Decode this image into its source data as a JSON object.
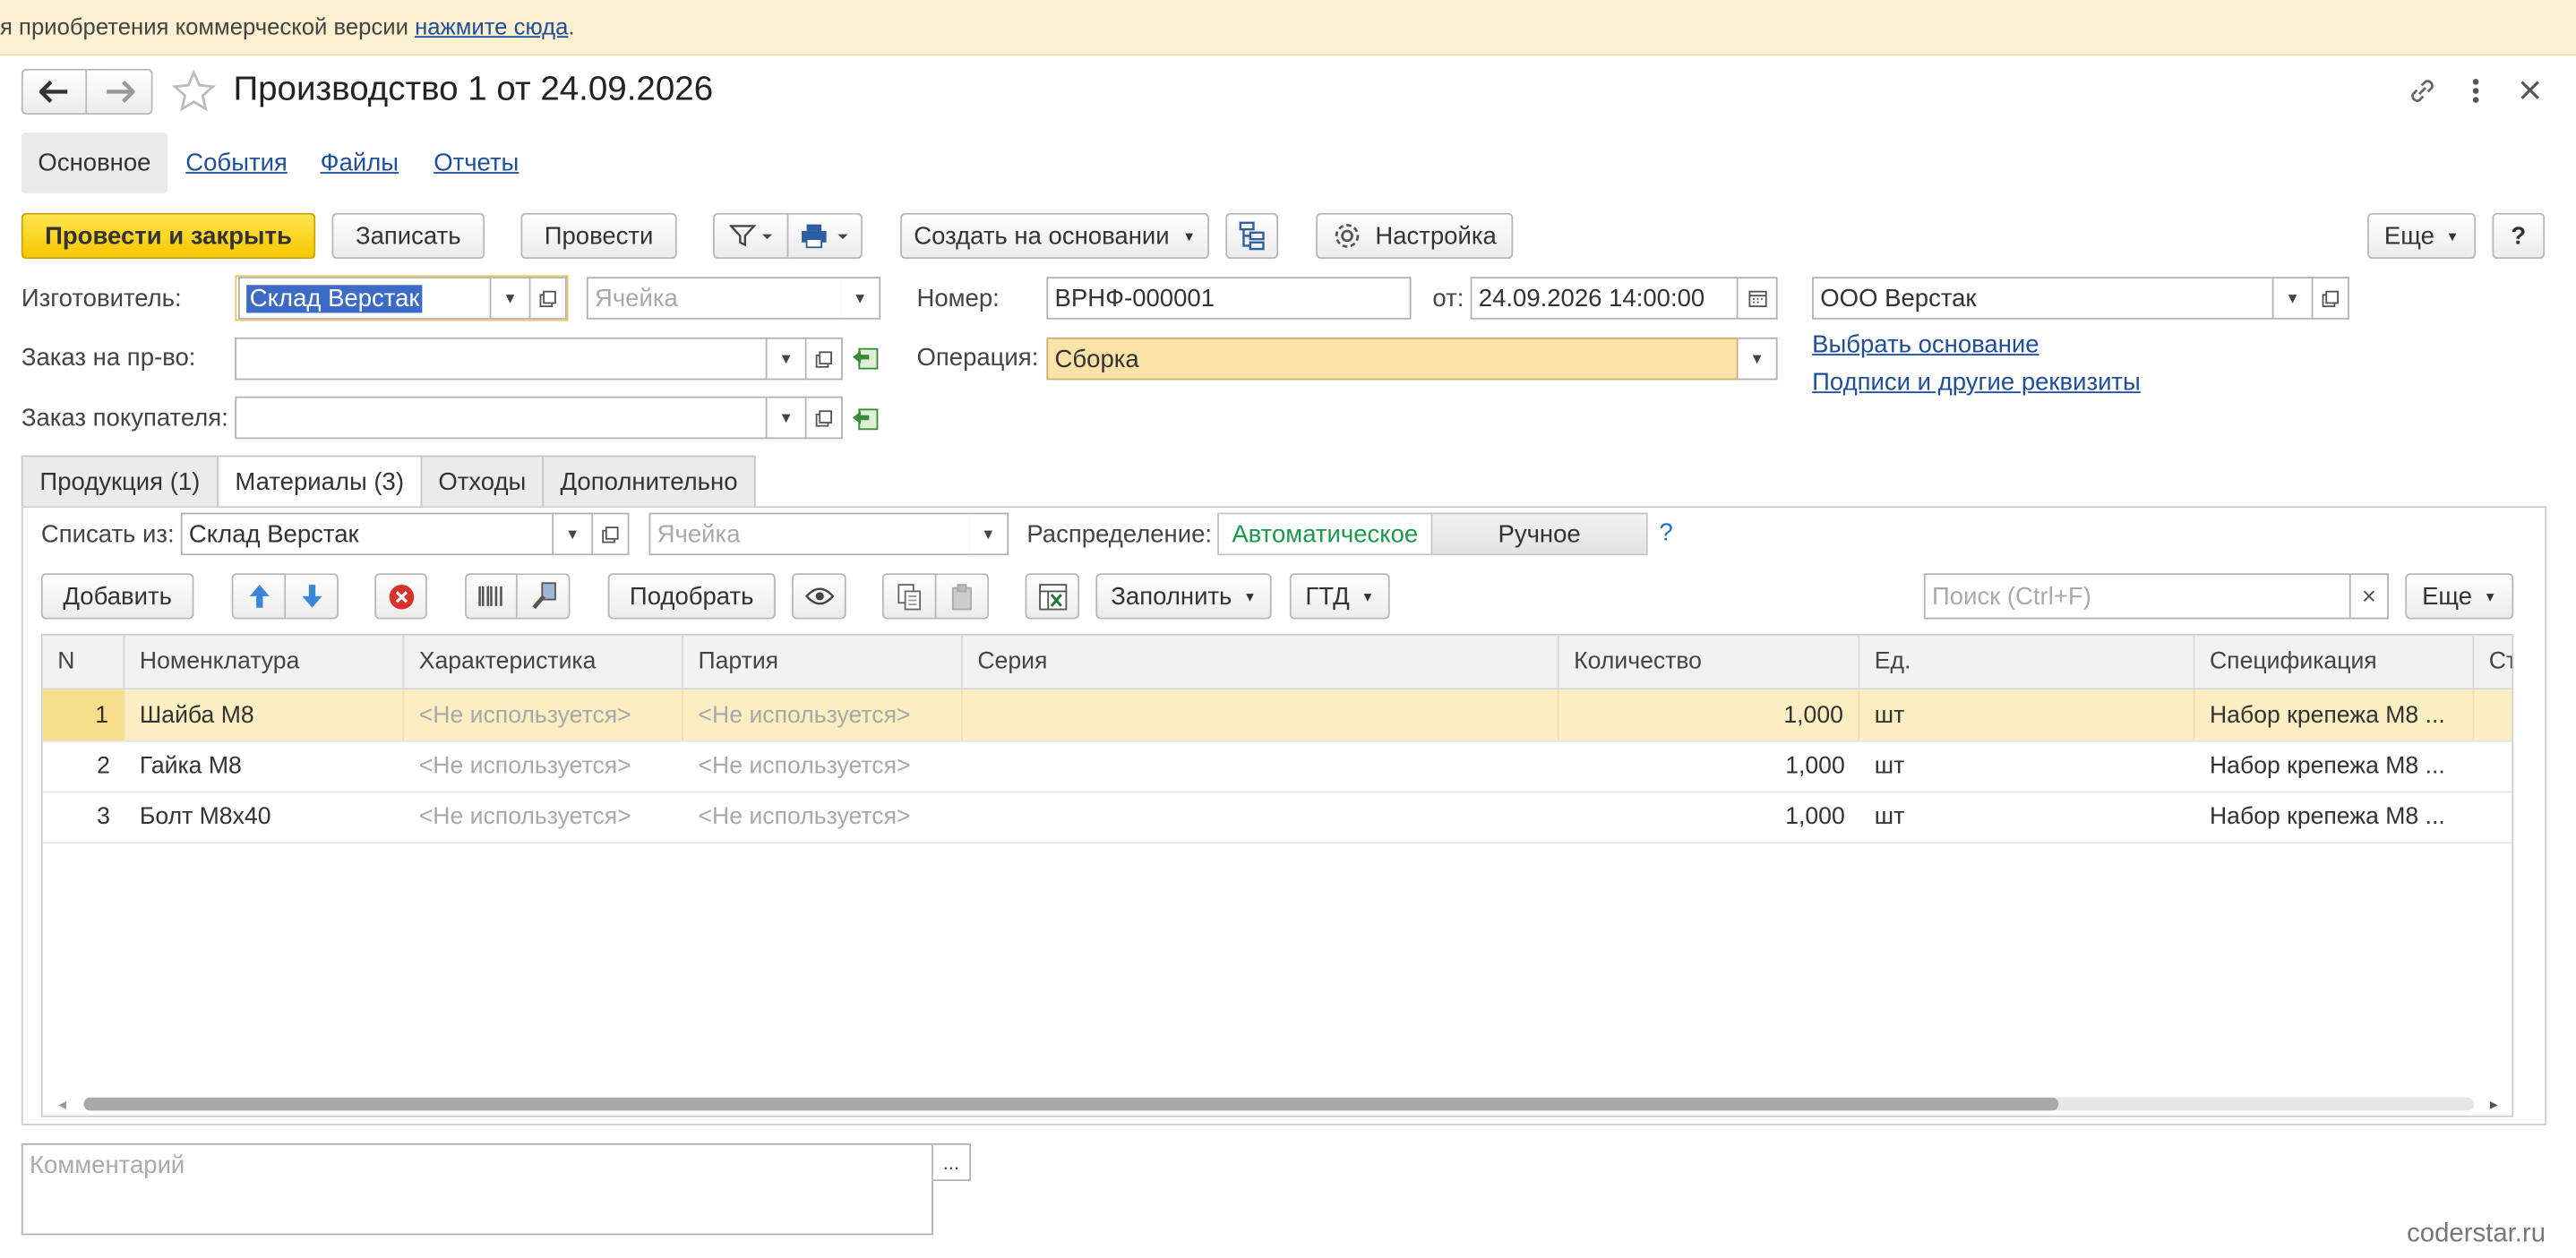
{
  "banner": {
    "prefix": "я приобретения коммерческой версии ",
    "link": "нажмите сюда",
    "suffix": "."
  },
  "window": {
    "title": "Производство 1 от 24.09.2026"
  },
  "nav": {
    "tabs": [
      {
        "label": "Основное"
      },
      {
        "label": "События"
      },
      {
        "label": "Файлы"
      },
      {
        "label": "Отчеты"
      }
    ]
  },
  "toolbar": {
    "post_close": "Провести и закрыть",
    "save": "Записать",
    "post": "Провести",
    "create_based": "Создать на основании",
    "settings": "Настройка",
    "more": "Еще",
    "help": "?"
  },
  "header": {
    "manufacturer_label": "Изготовитель:",
    "manufacturer_value": "Склад Верстак",
    "cell_placeholder": "Ячейка",
    "order_label": "Заказ на пр-во:",
    "order_value": "",
    "customer_order_label": "Заказ покупателя:",
    "customer_order_value": "",
    "number_label": "Номер:",
    "number_value": "ВРНФ-000001",
    "date_label": "от:",
    "date_value": "24.09.2026 14:00:00",
    "operation_label": "Операция:",
    "operation_value": "Сборка",
    "organization_value": "ООО Верстак",
    "choose_basis_link": "Выбрать основание",
    "signatures_link": "Подписи и другие реквизиты"
  },
  "tabs": [
    {
      "label": "Продукция (1)"
    },
    {
      "label": "Материалы (3)"
    },
    {
      "label": "Отходы"
    },
    {
      "label": "Дополнительно"
    }
  ],
  "materials": {
    "writeoff_label": "Списать из:",
    "writeoff_value": "Склад Верстак",
    "cell_placeholder": "Ячейка",
    "distribution_label": "Распределение:",
    "auto_label": "Автоматическое",
    "manual_label": "Ручное",
    "help": "?",
    "add": "Добавить",
    "pick": "Подобрать",
    "fill": "Заполнить",
    "gtd": "ГТД",
    "search_placeholder": "Поиск (Ctrl+F)",
    "more": "Еще",
    "columns": [
      "N",
      "Номенклатура",
      "Характеристика",
      "Партия",
      "Серия",
      "Количество",
      "Ед.",
      "Спецификация",
      "Ст"
    ],
    "rows": [
      {
        "n": "1",
        "item": "Шайба М8",
        "characteristic": "<Не используется>",
        "batch": "<Не используется>",
        "series": "",
        "qty": "1,000",
        "unit": "шт",
        "spec": "Набор крепежа М8 ..."
      },
      {
        "n": "2",
        "item": "Гайка М8",
        "characteristic": "<Не используется>",
        "batch": "<Не используется>",
        "series": "",
        "qty": "1,000",
        "unit": "шт",
        "spec": "Набор крепежа М8 ..."
      },
      {
        "n": "3",
        "item": "Болт М8х40",
        "characteristic": "<Не используется>",
        "batch": "<Не используется>",
        "series": "",
        "qty": "1,000",
        "unit": "шт",
        "spec": "Набор крепежа М8 ..."
      }
    ]
  },
  "comment": {
    "placeholder": "Комментарий",
    "button": "..."
  },
  "watermark": "coderstar.ru",
  "colors": {
    "primary": "#f7c800",
    "selection": "#fbeec2",
    "link": "#1f4f9c",
    "auto_green": "#1a9a4b",
    "banner": "#fbf0cf"
  },
  "icons": [
    "back-arrow-icon",
    "forward-arrow-icon",
    "star-icon",
    "link-icon",
    "more-vertical-icon",
    "close-icon",
    "filter-icon",
    "print-icon",
    "structure-icon",
    "gear-icon",
    "arrow-up-icon",
    "arrow-down-icon",
    "delete-icon",
    "barcode-icon",
    "scanner-icon",
    "eye-icon",
    "copy-icon",
    "paste-icon",
    "excel-icon",
    "calendar-icon"
  ]
}
